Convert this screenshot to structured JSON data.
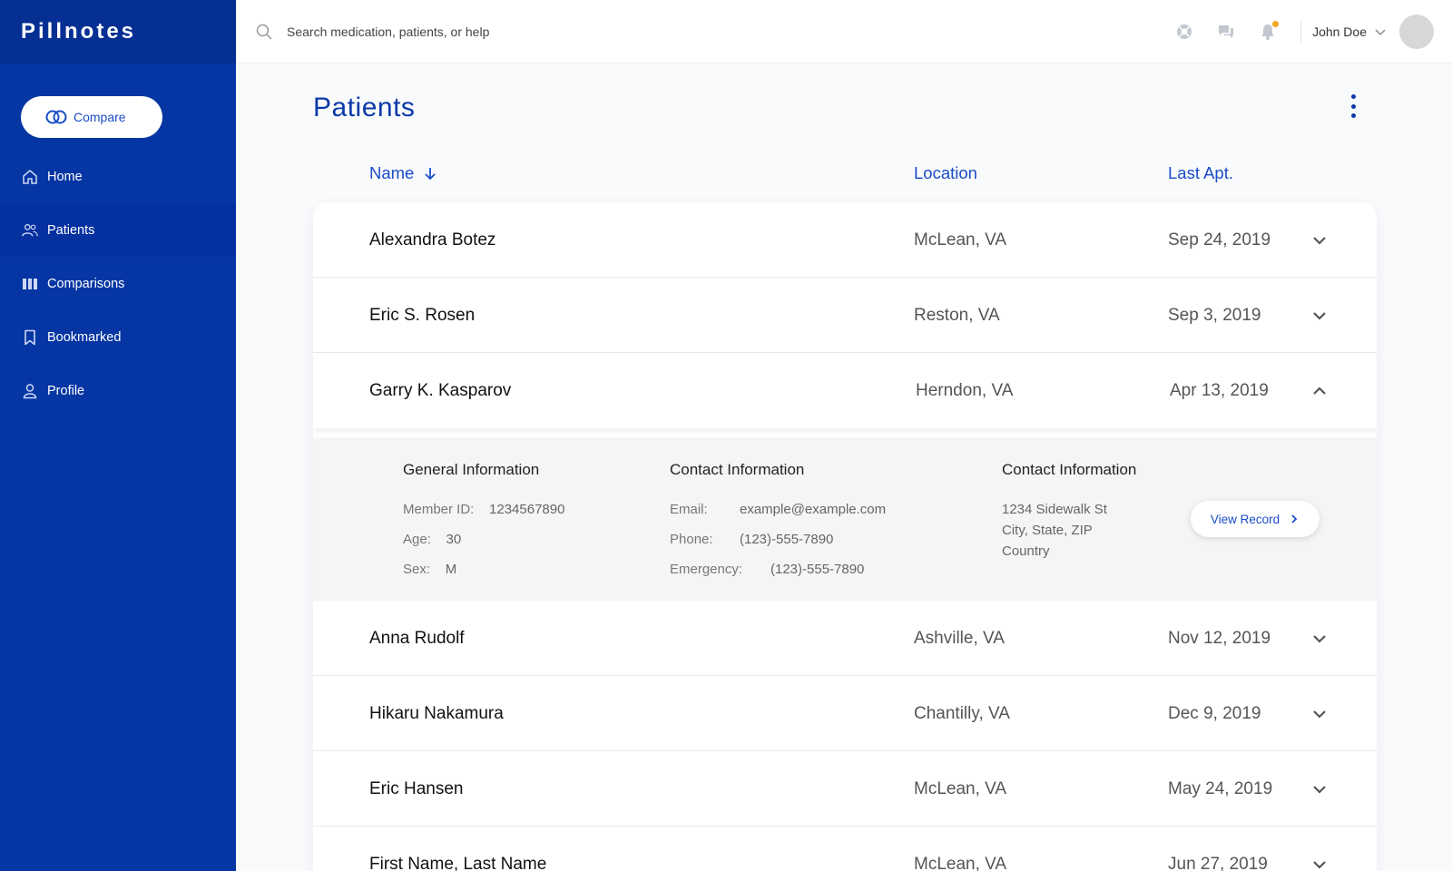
{
  "brand": "Pillnotes",
  "sidebar": {
    "compare_label": "Compare",
    "items": [
      {
        "label": "Home",
        "icon": "home-icon"
      },
      {
        "label": "Patients",
        "icon": "users-icon",
        "active": true
      },
      {
        "label": "Comparisons",
        "icon": "columns-icon"
      },
      {
        "label": "Bookmarked",
        "icon": "bookmark-icon"
      },
      {
        "label": "Profile",
        "icon": "user-icon"
      }
    ]
  },
  "topbar": {
    "search_placeholder": "Search medication, patients, or help",
    "user_name": "John Doe",
    "notification_dot_color": "#f5a623"
  },
  "page": {
    "title": "Patients"
  },
  "table": {
    "columns": {
      "name": "Name",
      "location": "Location",
      "last_apt": "Last Apt."
    },
    "rows": [
      {
        "name": "Alexandra Botez",
        "location": "McLean, VA",
        "last_apt": "Sep 24, 2019",
        "expanded": false
      },
      {
        "name": "Eric S. Rosen",
        "location": "Reston, VA",
        "last_apt": "Sep 3, 2019",
        "expanded": false
      },
      {
        "name": "Garry K. Kasparov",
        "location": "Herndon, VA",
        "last_apt": "Apr 13, 2019",
        "expanded": true
      },
      {
        "name": "Anna Rudolf",
        "location": "Ashville, VA",
        "last_apt": "Nov 12, 2019",
        "expanded": false
      },
      {
        "name": "Hikaru Nakamura",
        "location": "Chantilly, VA",
        "last_apt": "Dec 9, 2019",
        "expanded": false
      },
      {
        "name": "Eric Hansen",
        "location": "McLean, VA",
        "last_apt": "May 24, 2019",
        "expanded": false
      },
      {
        "name": "First Name, Last Name",
        "location": "McLean, VA",
        "last_apt": "Jun 27, 2019",
        "expanded": false
      }
    ],
    "detail": {
      "general": {
        "title": "General Information",
        "member_id_label": "Member ID:",
        "member_id": "1234567890",
        "age_label": "Age:",
        "age": "30",
        "sex_label": "Sex:",
        "sex": "M"
      },
      "contact": {
        "title": "Contact Information",
        "email_label": "Email:",
        "email": "example@example.com",
        "phone_label": "Phone:",
        "phone": "(123)-555-7890",
        "emergency_label": "Emergency:",
        "emergency": "(123)-555-7890"
      },
      "address": {
        "title": "Contact Information",
        "line1": "1234 Sidewalk St",
        "line2": "City, State, ZIP",
        "line3": "Country"
      },
      "view_record_label": "View Record"
    }
  },
  "colors": {
    "sidebar_bg": "#0636a3",
    "brand_bg": "#062f93",
    "accent": "#1a4cc8",
    "title": "#0b3aa8"
  }
}
